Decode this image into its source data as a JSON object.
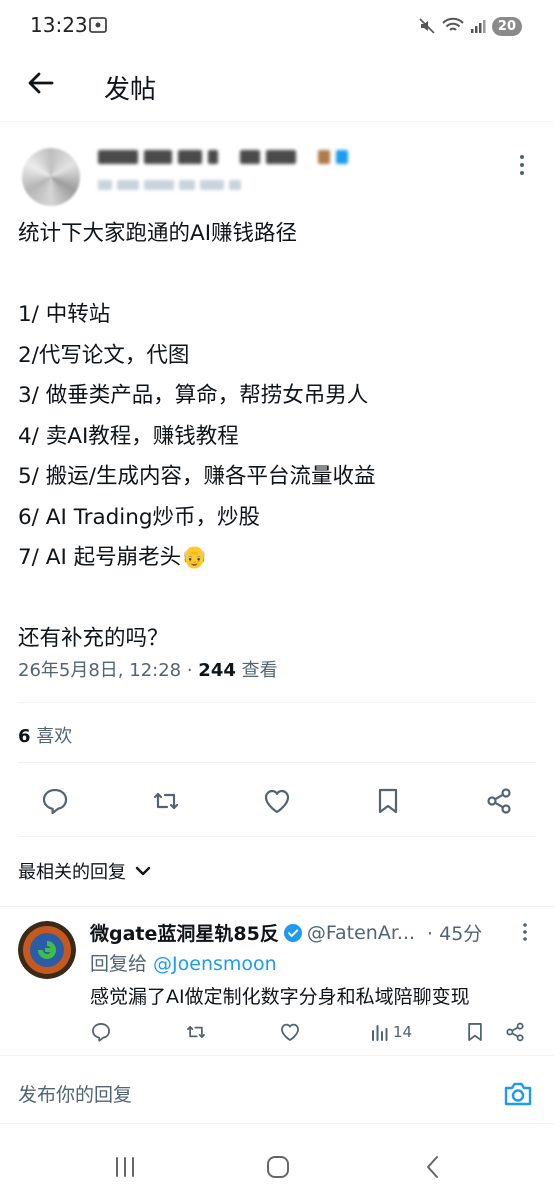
{
  "status_bar": {
    "time": "13:23",
    "battery": "20"
  },
  "header": {
    "title": "发帖"
  },
  "tweet": {
    "lines": [
      "统计下大家跑通的AI赚钱路径",
      "",
      "1/ 中转站",
      "2/代写论文，代图",
      "3/ 做垂类产品，算命，帮捞女吊男人",
      "4/ 卖AI教程，赚钱教程",
      "5/ 搬运/生成内容，赚各平台流量收益",
      "6/ AI Trading炒币，炒股",
      "7/ AI 起号崩老头👴",
      "",
      "还有补充的吗？"
    ],
    "timestamp": "26年5月8日, 12:28 · ",
    "views_count": "244",
    "views_label": " 查看",
    "likes_count": "6",
    "likes_label": " 喜欢"
  },
  "replies_sort": {
    "label": "最相关的回复"
  },
  "reply": {
    "name": "微gate蓝洞星轨85反",
    "handle": "@FatenAr...",
    "time": "· 45分",
    "reply_to_prefix": "回复给 ",
    "reply_to_user": "@Joensmoon",
    "body": "感觉漏了AI做定制化数字分身和私域陪聊变现",
    "views": "14"
  },
  "compose": {
    "placeholder": "发布你的回复"
  },
  "colors": {
    "accent": "#1d9bf0",
    "text": "#0f1419",
    "secondary": "#536471",
    "divider": "#eff3f4"
  }
}
